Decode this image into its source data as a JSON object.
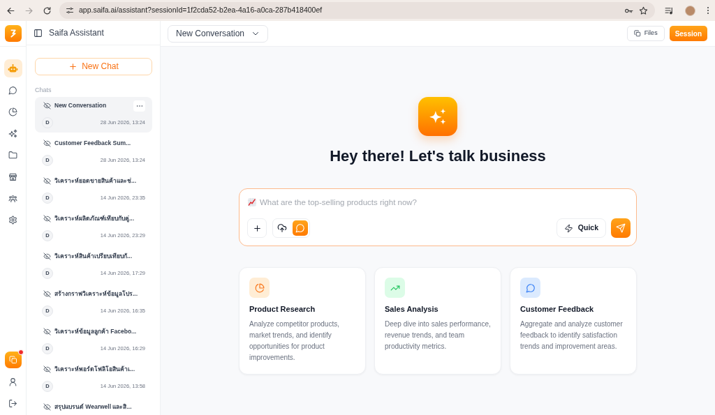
{
  "browser": {
    "controls": [
      {
        "kind": "back",
        "disabled": false
      },
      {
        "kind": "forward",
        "disabled": true
      },
      {
        "kind": "reload",
        "disabled": false
      }
    ],
    "url": "app.saifa.ai/assistant?sessionId=1f2cda52-b2ea-4a16-a0ca-287b418400ef"
  },
  "rail": {
    "items": [
      {
        "kind": "bot",
        "selected": true
      },
      {
        "kind": "chat",
        "selected": false
      },
      {
        "kind": "pie",
        "selected": false
      },
      {
        "kind": "sparkles",
        "selected": false
      },
      {
        "kind": "folder",
        "selected": false
      },
      {
        "kind": "store",
        "selected": false
      },
      {
        "kind": "users",
        "selected": false
      },
      {
        "kind": "settings",
        "selected": false
      }
    ],
    "bottom_items": [
      {
        "kind": "copy",
        "badge": true
      },
      {
        "kind": "user",
        "badge": false
      },
      {
        "kind": "logout",
        "badge": false
      }
    ]
  },
  "sidebar": {
    "title": "Saifa Assistant",
    "new_chat": "New Chat",
    "section": "Chats",
    "chats": [
      {
        "title": "New Conversation",
        "avatar": "D",
        "date": "28 Jun 2026, 13:24",
        "selected": true
      },
      {
        "title": "Customer Feedback Sum...",
        "avatar": "D",
        "date": "28 Jun 2026, 13:24",
        "selected": false
      },
      {
        "title": "วิเคราะห์ยอดขายสินค้าและช่...",
        "avatar": "D",
        "date": "14 Jun 2026, 23:35",
        "selected": false
      },
      {
        "title": "วิเคราะห์ผลิตภัณฑ์เทียบกับคู่...",
        "avatar": "D",
        "date": "14 Jun 2026, 23:29",
        "selected": false
      },
      {
        "title": "วิเคราะห์สินค้าเปรียบเทียบกั...",
        "avatar": "D",
        "date": "14 Jun 2026, 17:29",
        "selected": false
      },
      {
        "title": "สร้างกราฟวิเคราะห์ข้อมูลโปร...",
        "avatar": "D",
        "date": "14 Jun 2026, 16:35",
        "selected": false
      },
      {
        "title": "วิเคราะห์ข้อมูลลูกค้า Facebo...",
        "avatar": "D",
        "date": "14 Jun 2026, 16:29",
        "selected": false
      },
      {
        "title": "วิเคราะห์พอร์ตโฟลิโอสินค้าเ...",
        "avatar": "D",
        "date": "14 Jun 2026, 13:58",
        "selected": false
      },
      {
        "title": "สรุปแบรนด์ Wearwell และสิ...",
        "selected": false
      }
    ]
  },
  "top_bar": {
    "conversation": "New Conversation",
    "files": "Files",
    "session": "Session"
  },
  "hero": {
    "heading": "Hey there! Let's talk business"
  },
  "composer": {
    "placeholder": "What are the top-selling products right now?",
    "modes": [
      {
        "kind": "upload",
        "selected": false
      },
      {
        "kind": "chat",
        "selected": true
      }
    ],
    "quick": "Quick"
  },
  "cards": [
    {
      "kind": "pie",
      "title": "Product Research",
      "description": "Analyze competitor products, market trends, and identify opportunities for product improvements."
    },
    {
      "kind": "trend",
      "title": "Sales Analysis",
      "description": "Deep dive into sales performance, revenue trends, and team productivity metrics."
    },
    {
      "kind": "chat",
      "title": "Customer Feedback",
      "description": "Aggregate and analyze customer feedback to identify satisfaction trends and improvement areas."
    }
  ]
}
